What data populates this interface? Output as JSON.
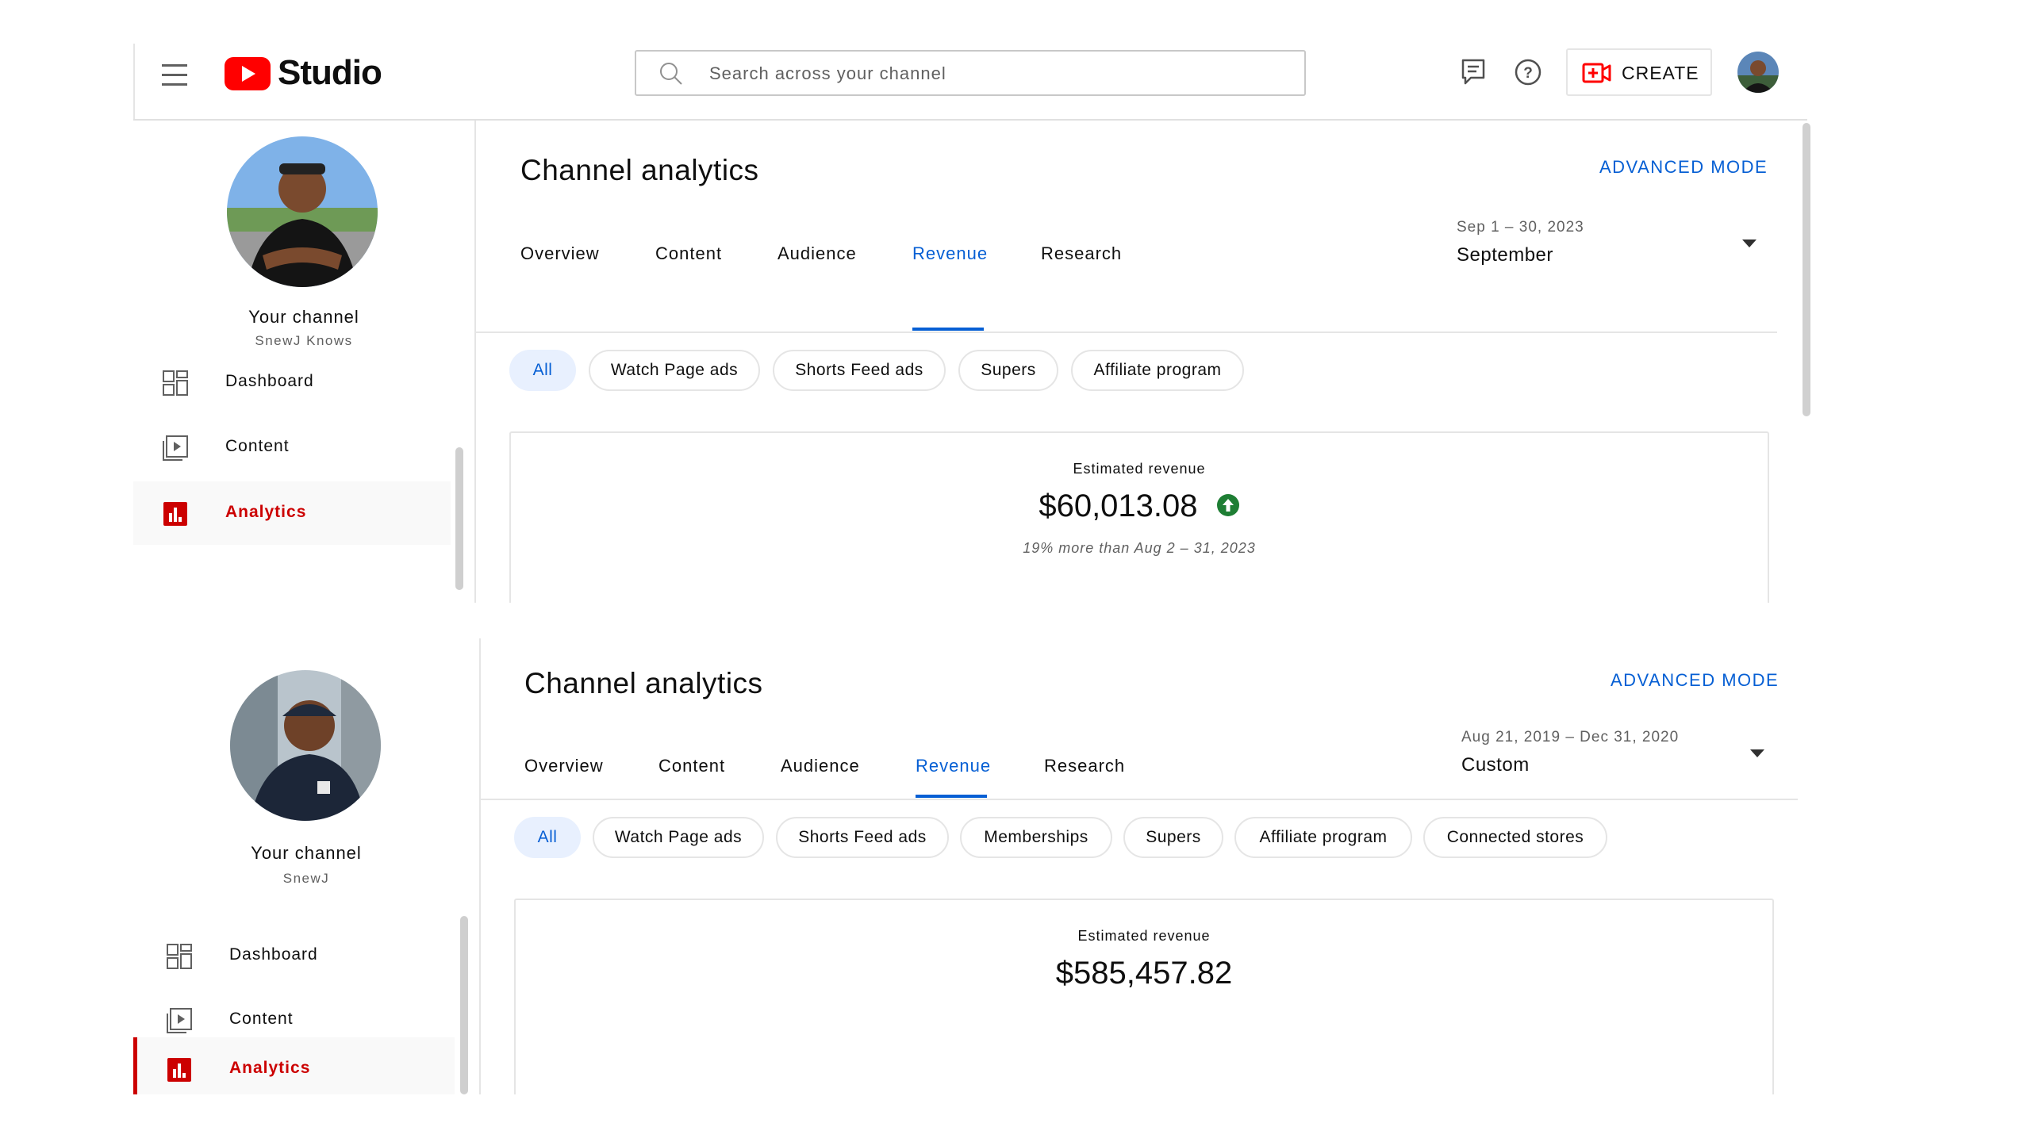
{
  "app": {
    "logo_text": "Studio"
  },
  "header": {
    "search_placeholder": "Search across your channel",
    "create_label": "CREATE"
  },
  "screens": [
    {
      "channel": {
        "title": "Your channel",
        "name": "SnewJ Knows"
      },
      "nav": [
        {
          "label": "Dashboard",
          "icon": "dashboard-icon"
        },
        {
          "label": "Content",
          "icon": "content-icon"
        },
        {
          "label": "Analytics",
          "icon": "analytics-icon",
          "active": true
        }
      ],
      "page_title": "Channel analytics",
      "advanced_mode": "ADVANCED MODE",
      "tabs": [
        "Overview",
        "Content",
        "Audience",
        "Revenue",
        "Research"
      ],
      "active_tab": "Revenue",
      "date_range": "Sep 1 – 30, 2023",
      "date_label": "September",
      "chips": [
        "All",
        "Watch Page ads",
        "Shorts Feed ads",
        "Supers",
        "Affiliate program"
      ],
      "metric": {
        "label": "Estimated revenue",
        "value": "$60,013.08",
        "trend_icon": "arrow-up-circle-icon",
        "trend_color": "#1e7e34",
        "note": "19% more than Aug 2 – 31, 2023"
      }
    },
    {
      "channel": {
        "title": "Your channel",
        "name": "SnewJ"
      },
      "nav": [
        {
          "label": "Dashboard",
          "icon": "dashboard-icon"
        },
        {
          "label": "Content",
          "icon": "content-icon"
        },
        {
          "label": "Analytics",
          "icon": "analytics-icon",
          "active": true
        }
      ],
      "page_title": "Channel analytics",
      "advanced_mode": "ADVANCED MODE",
      "tabs": [
        "Overview",
        "Content",
        "Audience",
        "Revenue",
        "Research"
      ],
      "active_tab": "Revenue",
      "date_range": "Aug 21, 2019 – Dec 31, 2020",
      "date_label": "Custom",
      "chips": [
        "All",
        "Watch Page ads",
        "Shorts Feed ads",
        "Memberships",
        "Supers",
        "Affiliate program",
        "Connected stores"
      ],
      "metric": {
        "label": "Estimated revenue",
        "value": "$585,457.82"
      }
    }
  ],
  "colors": {
    "accent": "#065fd4",
    "brand_red": "#ff0000",
    "active_nav": "#cc0000"
  }
}
